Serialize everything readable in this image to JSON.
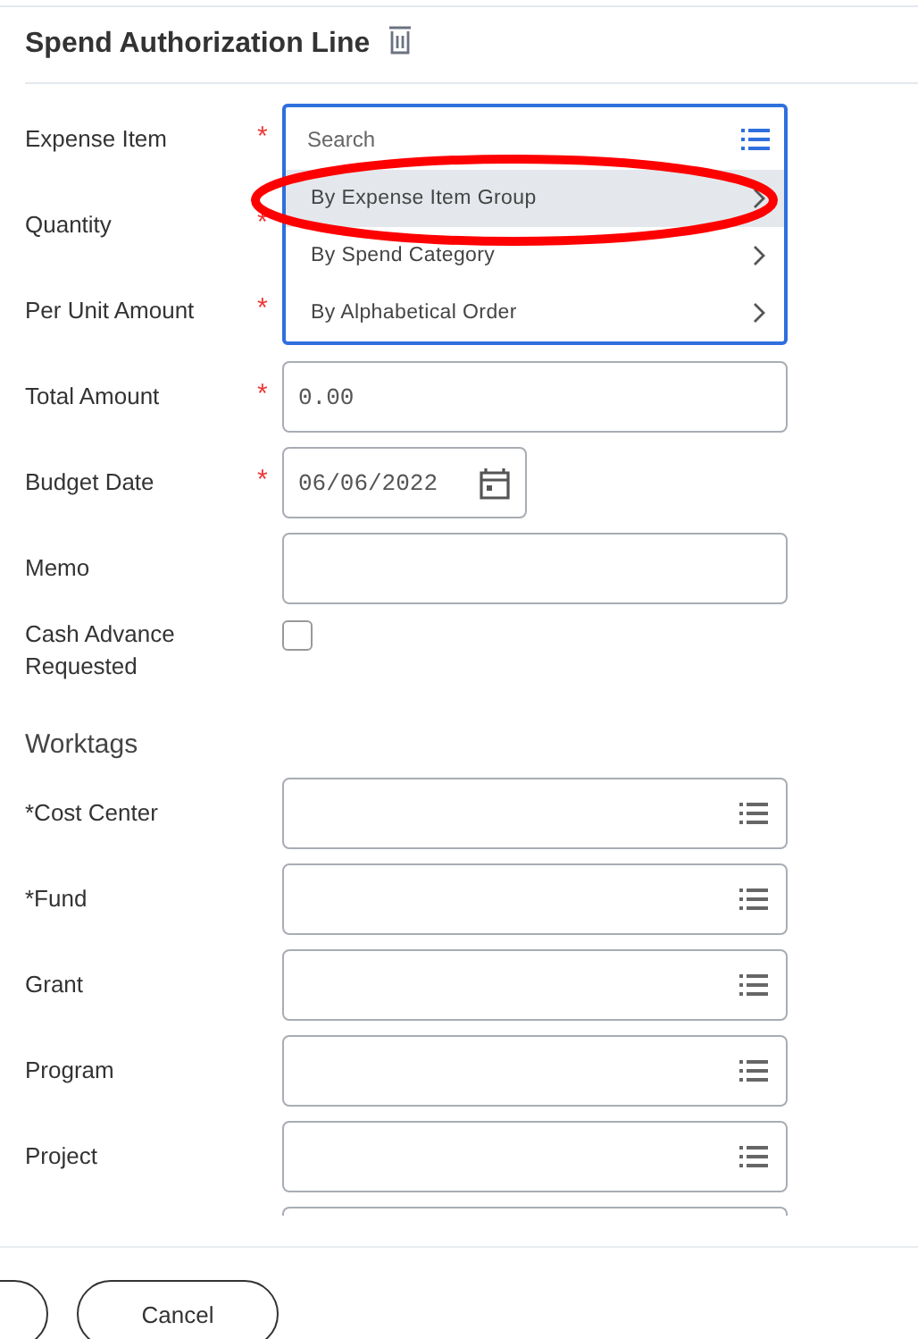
{
  "header": {
    "title": "Spend Authorization Line"
  },
  "fields": [
    {
      "label": "Expense Item",
      "required_mark": "*",
      "kind": "dropdown",
      "placeholder": "Search",
      "options": [
        {
          "label": "By Expense Item Group",
          "selected": true
        },
        {
          "label": "By Spend Category",
          "selected": false
        },
        {
          "label": "By Alphabetical Order",
          "selected": false
        }
      ]
    },
    {
      "label": "Quantity",
      "required_mark": "*",
      "kind": "hidden"
    },
    {
      "label": "Per Unit Amount",
      "required_mark": "*",
      "kind": "hidden"
    },
    {
      "label": "Total Amount",
      "required_mark": "*",
      "kind": "text",
      "value": "0.00"
    },
    {
      "label": "Budget Date",
      "required_mark": "*",
      "kind": "date",
      "value": "06/06/2022"
    },
    {
      "label": "Memo",
      "kind": "text"
    },
    {
      "label": "Cash Advance Requested",
      "kind": "checkbox",
      "checked": false
    }
  ],
  "worktags": {
    "title": "Worktags",
    "fields": [
      {
        "label": "*Cost Center"
      },
      {
        "label": "*Fund"
      },
      {
        "label": "Grant"
      },
      {
        "label": "Program"
      },
      {
        "label": "Project"
      }
    ]
  },
  "footer": {
    "buttons": [
      {
        "kind": "cut"
      },
      {
        "kind": "full",
        "label": "Cancel"
      }
    ]
  },
  "annotations": [
    {
      "kind": "ellipse",
      "color": "#ff0000"
    }
  ]
}
